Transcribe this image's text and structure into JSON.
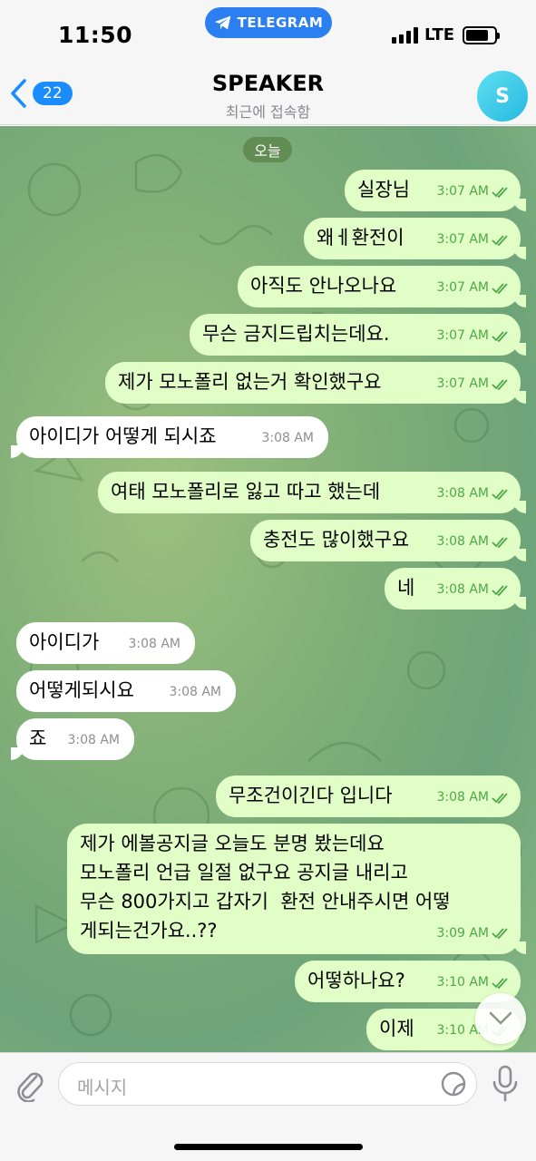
{
  "status_bar": {
    "time": "11:50",
    "app_pill": "TELEGRAM",
    "network": "LTE"
  },
  "header": {
    "back_count": "22",
    "title": "SPEAKER",
    "subtitle": "최근에 접속함",
    "avatar_letter": "S"
  },
  "date_label": "오늘",
  "messages": [
    {
      "dir": "out",
      "text": "실장님",
      "time": "3:07 AM"
    },
    {
      "dir": "out",
      "text": "왜ㅔ환전이",
      "time": "3:07 AM"
    },
    {
      "dir": "out",
      "text": "아직도 안나오나요",
      "time": "3:07 AM"
    },
    {
      "dir": "out",
      "text": "무슨 금지드립치는데요.",
      "time": "3:07 AM"
    },
    {
      "dir": "out",
      "text": "제가 모노폴리 없는거 확인했구요",
      "time": "3:07 AM"
    },
    {
      "dir": "in",
      "text": "아이디가 어떻게 되시죠",
      "time": "3:08 AM"
    },
    {
      "dir": "out",
      "text": "여태 모노폴리로 잃고 따고 했는데",
      "time": "3:08 AM"
    },
    {
      "dir": "out",
      "text": "충전도 많이했구요",
      "time": "3:08 AM"
    },
    {
      "dir": "out",
      "text": "네",
      "time": "3:08 AM"
    },
    {
      "dir": "in",
      "text": "아이디가",
      "time": "3:08 AM"
    },
    {
      "dir": "in",
      "text": "어떻게되시요",
      "time": "3:08 AM"
    },
    {
      "dir": "in",
      "text": "죠",
      "time": "3:08 AM"
    },
    {
      "dir": "out",
      "text": "무조건이긴다 입니다",
      "time": "3:08 AM"
    },
    {
      "dir": "out",
      "text": "제가 에볼공지글 오늘도 분명 봤는데요\n모노폴리 언급 일절 없구요 공지글 내리고\n무슨 800가지고 갑자기  환전 안내주시면 어떻\n게되는건가요..??",
      "time": "3:09 AM"
    },
    {
      "dir": "out",
      "text": "어떻하나요?",
      "time": "3:10 AM"
    },
    {
      "dir": "out",
      "text": "이제",
      "time": "3:10 AM"
    }
  ],
  "input": {
    "placeholder": "메시지"
  },
  "icons": {
    "back": "chevron-left-icon",
    "attach": "paperclip-icon",
    "sticker": "sticker-icon",
    "mic": "microphone-icon",
    "scroll": "chevron-down-icon",
    "read": "double-check-icon"
  },
  "colors": {
    "outgoing_bubble": "#e1fec6",
    "incoming_bubble": "#ffffff",
    "accent": "#1a8cff",
    "check": "#4ea84a"
  }
}
